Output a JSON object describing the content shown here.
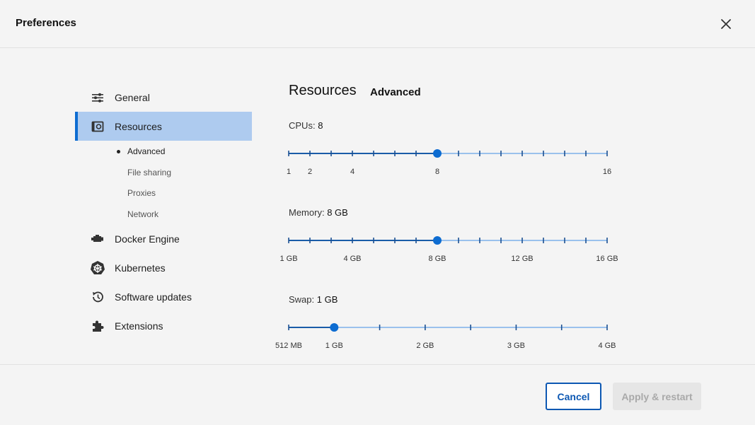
{
  "window": {
    "title": "Preferences",
    "close_icon": "close-icon"
  },
  "sidebar": {
    "items": [
      {
        "label": "General",
        "icon": "sliders-icon",
        "active": false
      },
      {
        "label": "Resources",
        "icon": "resources-icon",
        "active": true
      },
      {
        "label": "Docker Engine",
        "icon": "engine-icon",
        "active": false
      },
      {
        "label": "Kubernetes",
        "icon": "kubernetes-icon",
        "active": false
      },
      {
        "label": "Software updates",
        "icon": "history-icon",
        "active": false
      },
      {
        "label": "Extensions",
        "icon": "puzzle-icon",
        "active": false
      }
    ],
    "resources_subitems": [
      {
        "label": "Advanced",
        "current": true
      },
      {
        "label": "File sharing",
        "current": false
      },
      {
        "label": "Proxies",
        "current": false
      },
      {
        "label": "Network",
        "current": false
      }
    ]
  },
  "content": {
    "title": "Resources",
    "subtitle": "Advanced",
    "settings": [
      {
        "key": "cpus",
        "label": "CPUs:",
        "value": "8",
        "tick_count": 16,
        "selected_index": 7,
        "tick_labels": [
          {
            "index": 0,
            "text": "1"
          },
          {
            "index": 1,
            "text": "2"
          },
          {
            "index": 3,
            "text": "4"
          },
          {
            "index": 7,
            "text": "8"
          },
          {
            "index": 15,
            "text": "16"
          }
        ]
      },
      {
        "key": "memory",
        "label": "Memory:",
        "value": "8 GB",
        "tick_count": 16,
        "selected_index": 7,
        "tick_labels": [
          {
            "index": 0,
            "text": "1 GB"
          },
          {
            "index": 3,
            "text": "4 GB"
          },
          {
            "index": 7,
            "text": "8 GB"
          },
          {
            "index": 11,
            "text": "12 GB"
          },
          {
            "index": 15,
            "text": "16 GB"
          }
        ]
      },
      {
        "key": "swap",
        "label": "Swap:",
        "value": "1 GB",
        "tick_count": 8,
        "selected_index": 1,
        "tick_labels": [
          {
            "index": 0,
            "text": "512 MB"
          },
          {
            "index": 1,
            "text": "1 GB"
          },
          {
            "index": 3,
            "text": "2 GB"
          },
          {
            "index": 5,
            "text": "3 GB"
          },
          {
            "index": 7,
            "text": "4 GB"
          }
        ]
      }
    ]
  },
  "footer": {
    "cancel_label": "Cancel",
    "apply_label": "Apply & restart",
    "apply_enabled": false
  },
  "colors": {
    "accent": "#0d6cd1",
    "track_filled": "#1a5ca8",
    "track_empty": "#9ac1ec",
    "active_nav_bg": "#aecbef"
  }
}
